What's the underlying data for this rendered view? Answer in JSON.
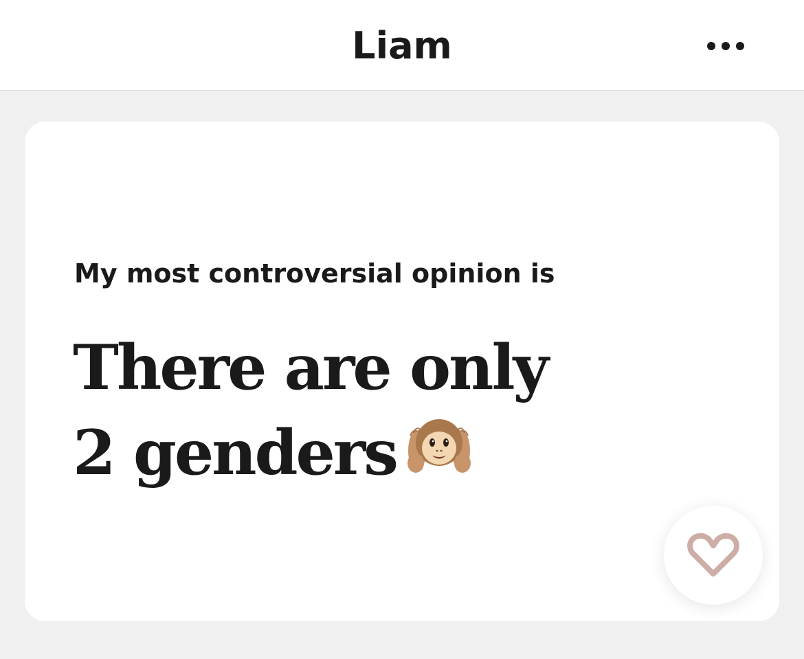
{
  "header": {
    "title": "Liam",
    "more_icon": "more-horizontal-icon"
  },
  "card": {
    "prompt": "My most controversial opinion is",
    "answer": "There are only 2 genders",
    "answer_emoji": "hear-no-evil-monkey",
    "like_icon": "heart-outline-icon"
  },
  "colors": {
    "background": "#f0f0f0",
    "card": "#ffffff",
    "text": "#1a1a1a",
    "heart": "#cdaea6"
  }
}
